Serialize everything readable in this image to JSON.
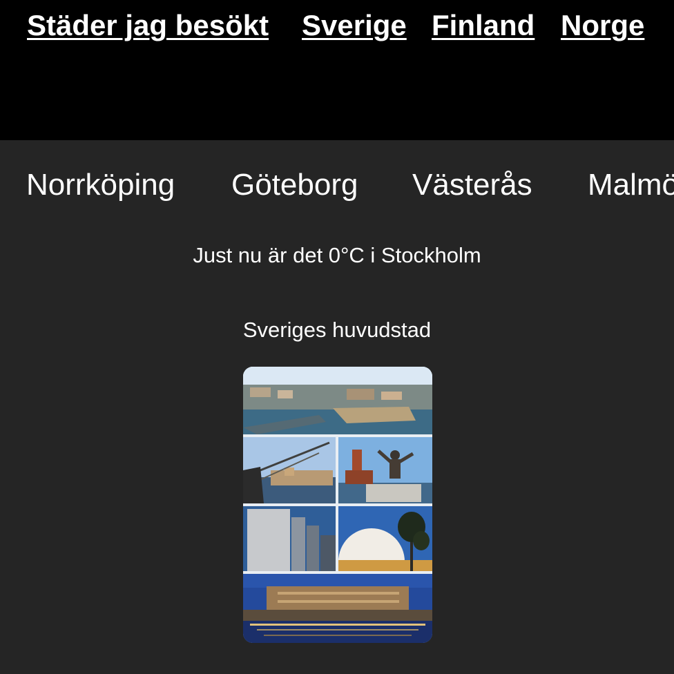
{
  "top_nav": {
    "items": [
      {
        "label": "Städer jag besökt"
      },
      {
        "label": "Sverige"
      },
      {
        "label": "Finland"
      },
      {
        "label": "Norge"
      }
    ]
  },
  "city_nav": {
    "items": [
      {
        "label": "Norrköping"
      },
      {
        "label": "Göteborg"
      },
      {
        "label": "Västerås"
      },
      {
        "label": "Malmö"
      }
    ]
  },
  "weather": {
    "text": "Just nu är det 0°C i Stockholm"
  },
  "feature": {
    "caption": "Sveriges huvudstad"
  },
  "colors": {
    "top_bar": "#000000",
    "page_background": "#252525",
    "text": "#ffffff"
  }
}
